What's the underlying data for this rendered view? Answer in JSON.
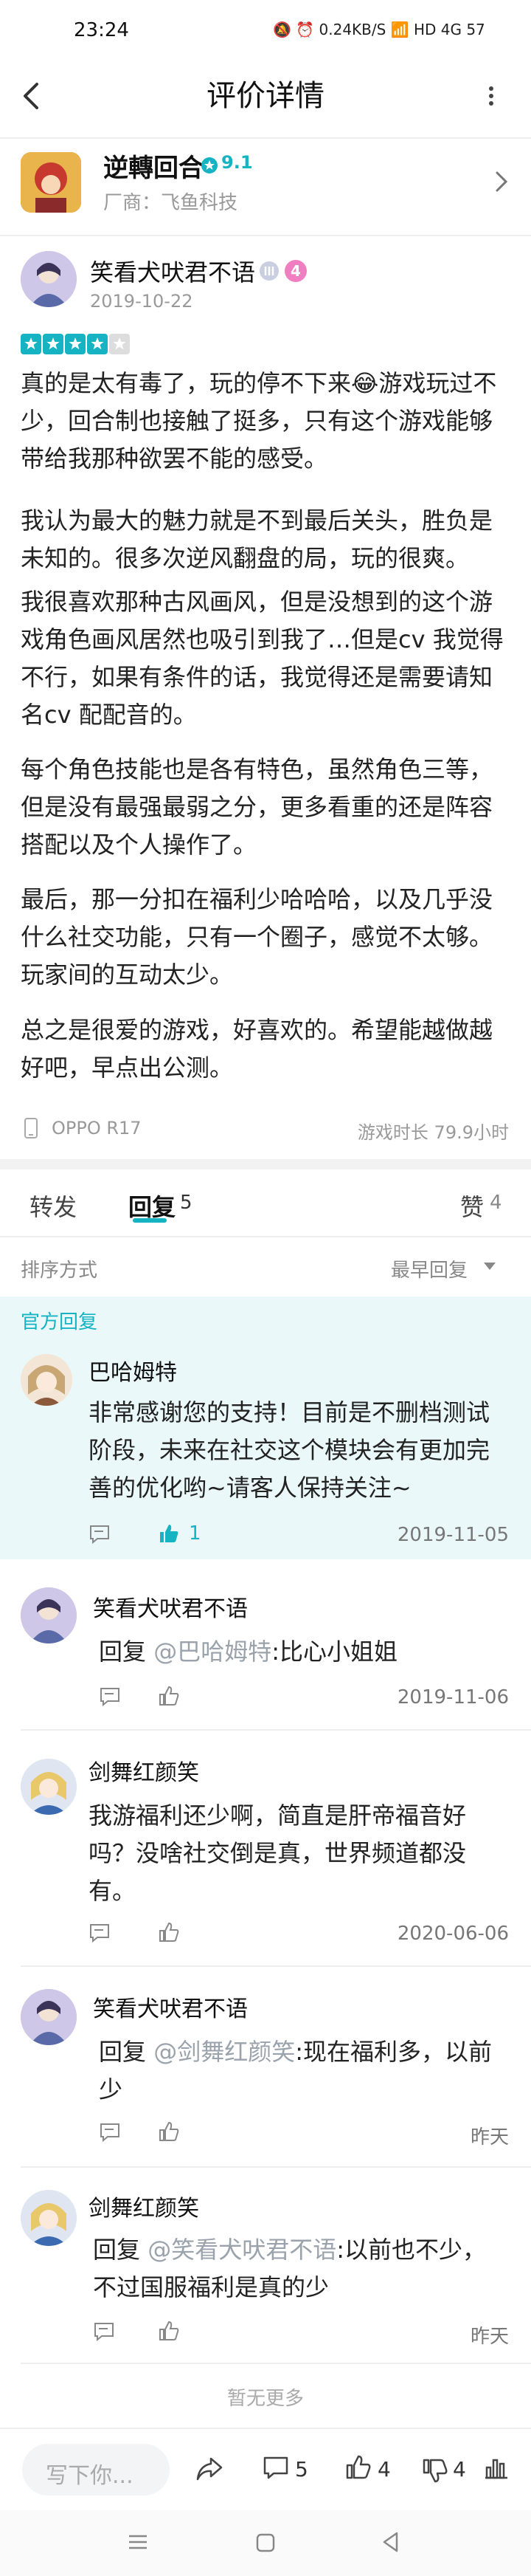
{
  "status": {
    "time": "23:24",
    "icons": "🔕 ⏰ 0.24KB/S 📶 HD 4G 57"
  },
  "header": {
    "title": "评价详情"
  },
  "game": {
    "name": "逆轉回合",
    "rating": "9.1",
    "developer": "厂商：飞鱼科技"
  },
  "review": {
    "author": "笑看犬吠君不语",
    "level": "4",
    "date": "2019-10-22",
    "stars": 4,
    "paragraphs": [
      "真的是太有毒了，玩的停不下来😂游戏玩过不少，回合制也接触了挺多，只有这个游戏能够带给我那种欲罢不能的感受。",
      "我认为最大的魅力就是不到最后关头，胜负是未知的。很多次逆风翻盘的局，玩的很爽。",
      "我很喜欢那种古风画风，但是没想到的这个游戏角色画风居然也吸引到我了…但是cv 我觉得不行，如果有条件的话，我觉得还是需要请知名cv 配配音的。",
      "每个角色技能也是各有特色，虽然角色三等，但是没有最强最弱之分，更多看重的还是阵容搭配以及个人操作了。",
      "最后，那一分扣在福利少哈哈哈，以及几乎没什么社交功能，只有一个圈子，感觉不太够。玩家间的互动太少。",
      "总之是很爱的游戏，好喜欢的。希望能越做越好吧，早点出公测。"
    ],
    "device": "OPPO R17",
    "playtime": "游戏时长 79.9小时"
  },
  "tabs": {
    "repost": "转发",
    "reply": "回复",
    "reply_count": "5",
    "like": "赞",
    "like_count": "4"
  },
  "sort": {
    "label": "排序方式",
    "value": "最早回复"
  },
  "official": {
    "label": "官方回复",
    "author": "巴哈姆特",
    "text": "非常感谢您的支持！目前是不删档测试阶段，未来在社交这个模块会有更加完善的优化哟~请客人保持关注~",
    "likes": "1",
    "date": "2019-11-05"
  },
  "replies": [
    {
      "author": "笑看犬吠君不语",
      "prefix": "回复 ",
      "mention": "@巴哈姆特",
      "text": ":比心小姐姐",
      "date": "2019-11-06"
    },
    {
      "author": "剑舞红颜笑",
      "prefix": "",
      "mention": "",
      "text": "我游福利还少啊，简直是肝帝福音好吗？没啥社交倒是真，世界频道都没有。",
      "date": "2020-06-06"
    },
    {
      "author": "笑看犬吠君不语",
      "prefix": "回复 ",
      "mention": "@剑舞红颜笑",
      "text": ":现在福利多，以前少",
      "date": "昨天"
    },
    {
      "author": "剑舞红颜笑",
      "prefix": "回复 ",
      "mention": "@笑看犬吠君不语",
      "text": ":以前也不少，不过国服福利是真的少",
      "date": "昨天"
    }
  ],
  "footer": {
    "no_more": "暂无更多"
  },
  "bottom": {
    "placeholder": "写下你...",
    "comments": "5",
    "likes": "4",
    "dislikes": "4"
  },
  "colors": {
    "accent": "#16b3c2",
    "official_bg": "#eaf8f9"
  }
}
